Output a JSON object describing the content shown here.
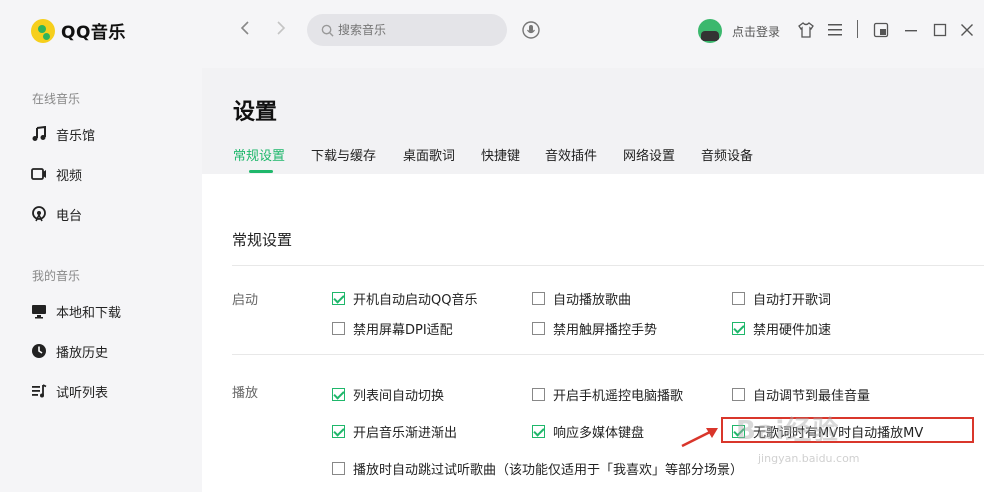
{
  "app": {
    "name": "QQ音乐"
  },
  "sidebar": {
    "online_title": "在线音乐",
    "online_items": [
      {
        "label": "音乐馆",
        "icon": "music-note-icon"
      },
      {
        "label": "视频",
        "icon": "video-icon"
      },
      {
        "label": "电台",
        "icon": "radio-icon"
      }
    ],
    "my_title": "我的音乐",
    "my_items": [
      {
        "label": "本地和下载",
        "icon": "monitor-icon"
      },
      {
        "label": "播放历史",
        "icon": "history-icon"
      },
      {
        "label": "试听列表",
        "icon": "playlist-icon"
      }
    ]
  },
  "topbar": {
    "back": "‹",
    "forward": "›",
    "search_placeholder": "搜索音乐",
    "login_label": "点击登录"
  },
  "header": {
    "title": "设置",
    "tabs": [
      "常规设置",
      "下载与缓存",
      "桌面歌词",
      "快捷键",
      "音效插件",
      "网络设置",
      "音频设备"
    ],
    "active_tab": 0
  },
  "content": {
    "section_title": "常规设置",
    "startup": {
      "label": "启动",
      "options": [
        {
          "label": "开机自动启动QQ音乐",
          "checked": true
        },
        {
          "label": "自动播放歌曲",
          "checked": false
        },
        {
          "label": "自动打开歌词",
          "checked": false
        },
        {
          "label": "禁用屏幕DPI适配",
          "checked": false
        },
        {
          "label": "禁用触屏播控手势",
          "checked": false
        },
        {
          "label": "禁用硬件加速",
          "checked": true
        }
      ]
    },
    "playback": {
      "label": "播放",
      "options": [
        {
          "label": "列表间自动切换",
          "checked": true
        },
        {
          "label": "开启手机遥控电脑播歌",
          "checked": false
        },
        {
          "label": "自动调节到最佳音量",
          "checked": false
        },
        {
          "label": "开启音乐渐进渐出",
          "checked": true
        },
        {
          "label": "响应多媒体键盘",
          "checked": true
        },
        {
          "label": "无歌词时有MV时自动播放MV",
          "checked": true
        },
        {
          "label": "播放时自动跳过试听歌曲（该功能仅适用于「我喜欢」等部分场景）",
          "checked": false
        }
      ]
    }
  },
  "watermark": {
    "brand": "Bai经验",
    "url": "jingyan.baidu.com"
  },
  "colors": {
    "accent": "#1fb76b",
    "highlight": "#d9362b",
    "sidebar_bg": "#f5f5f7"
  }
}
